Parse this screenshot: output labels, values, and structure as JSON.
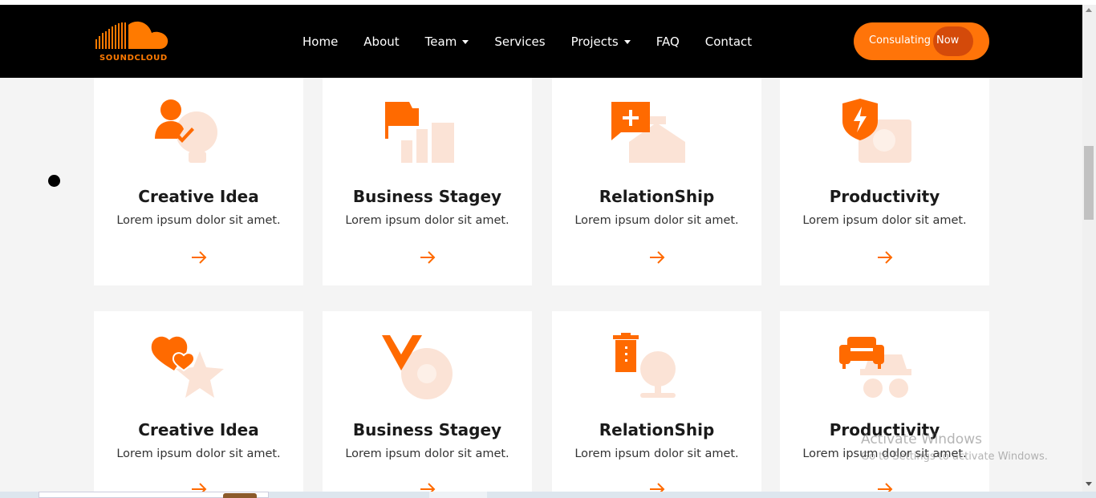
{
  "brand": {
    "name": "SOUNDCLOUD",
    "accent": "#ff7409"
  },
  "nav": {
    "items": [
      {
        "label": "Home",
        "dropdown": false
      },
      {
        "label": "About",
        "dropdown": false
      },
      {
        "label": "Team",
        "dropdown": true
      },
      {
        "label": "Services",
        "dropdown": false
      },
      {
        "label": "Projects",
        "dropdown": true
      },
      {
        "label": "FAQ",
        "dropdown": false
      },
      {
        "label": "Contact",
        "dropdown": false
      }
    ],
    "cta_label": "Consulating",
    "cta_badge": "Now"
  },
  "cards": [
    {
      "title": "Creative Idea",
      "desc": "Lorem ipsum dolor sit amet.",
      "icon": "user-check-icon"
    },
    {
      "title": "Business Stagey",
      "desc": "Lorem ipsum dolor sit amet.",
      "icon": "flag-icon"
    },
    {
      "title": "RelationShip",
      "desc": "Lorem ipsum dolor sit amet.",
      "icon": "message-plus-icon"
    },
    {
      "title": "Productivity",
      "desc": "Lorem ipsum dolor sit amet.",
      "icon": "shield-bolt-icon"
    },
    {
      "title": "Creative Idea",
      "desc": "Lorem ipsum dolor sit amet.",
      "icon": "hearts-icon"
    },
    {
      "title": "Business Stagey",
      "desc": "Lorem ipsum dolor sit amet.",
      "icon": "vuejs-icon"
    },
    {
      "title": "RelationShip",
      "desc": "Lorem ipsum dolor sit amet.",
      "icon": "trash-icon"
    },
    {
      "title": "Productivity",
      "desc": "Lorem ipsum dolor sit amet.",
      "icon": "couch-icon"
    }
  ],
  "watermark": {
    "title": "Activate Windows",
    "subtitle": "Go to Settings to activate Windows."
  }
}
